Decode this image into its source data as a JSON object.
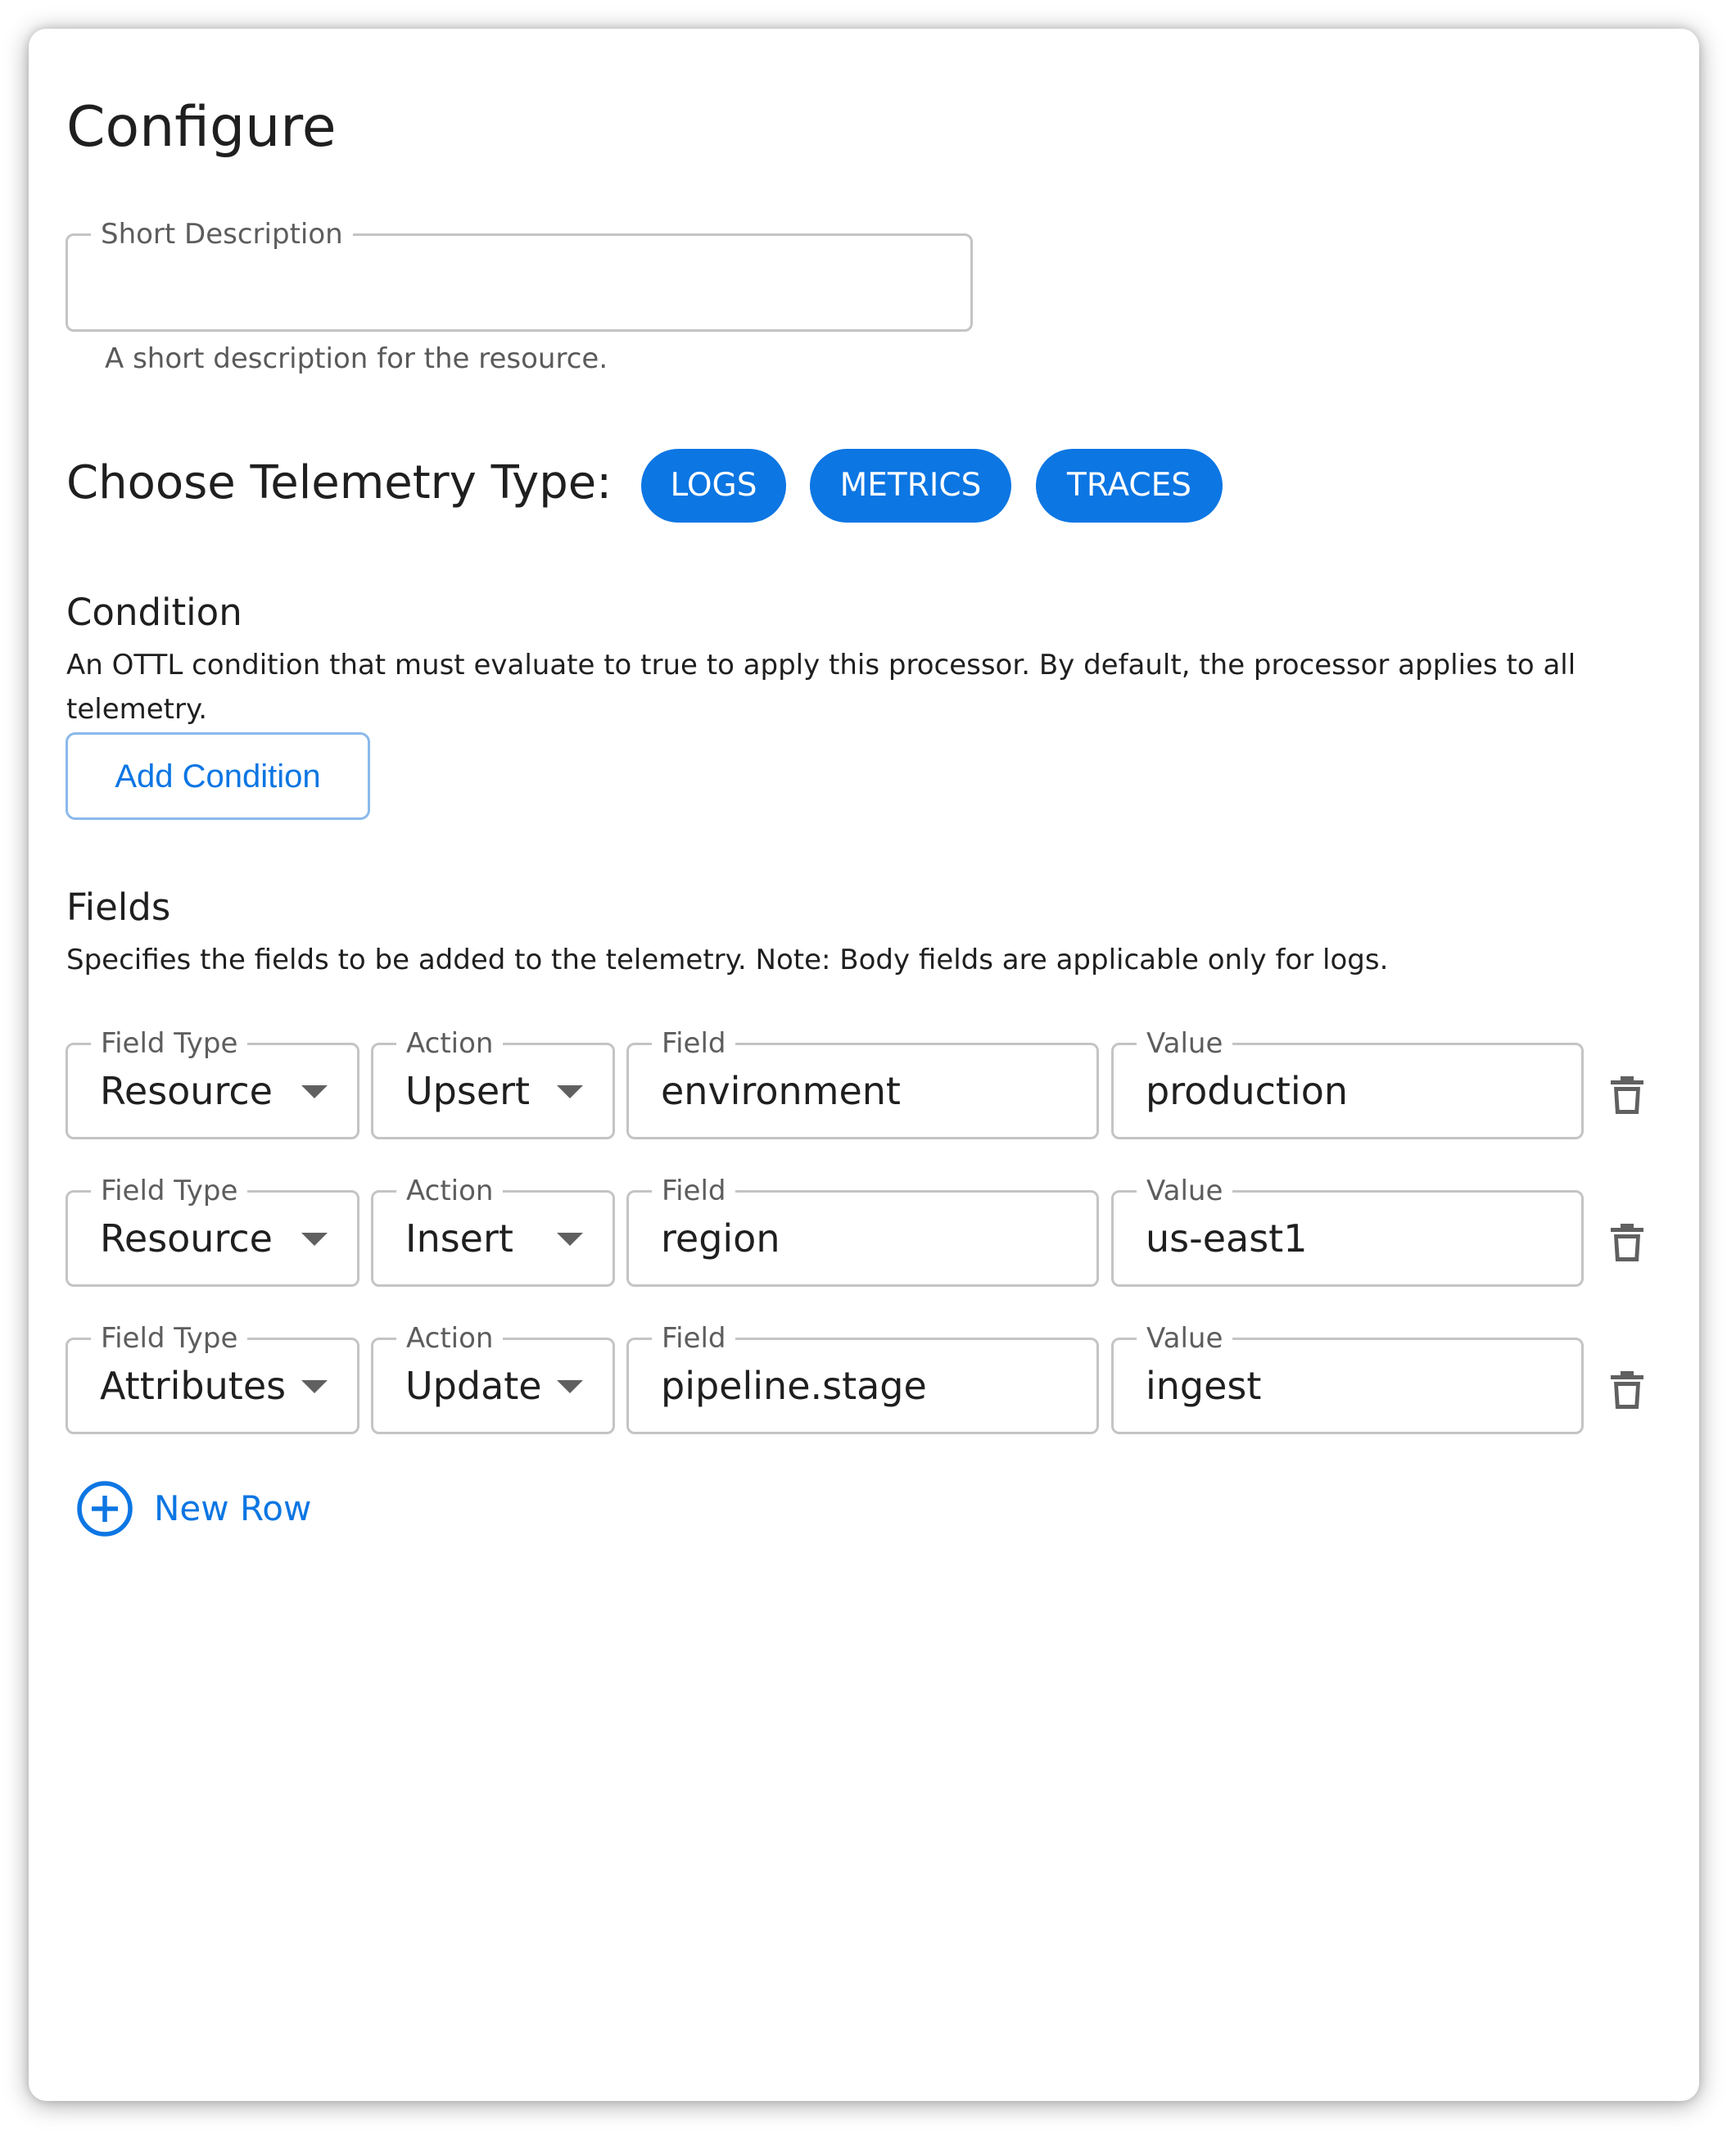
{
  "page": {
    "title": "Configure"
  },
  "short_description": {
    "label": "Short Description",
    "value": "",
    "helper": "A short description for the resource."
  },
  "telemetry": {
    "label": "Choose Telemetry Type:",
    "chips": [
      {
        "label": "LOGS",
        "selected": true
      },
      {
        "label": "METRICS",
        "selected": true
      },
      {
        "label": "TRACES",
        "selected": true
      }
    ]
  },
  "condition": {
    "title": "Condition",
    "description": "An OTTL condition that must evaluate to true to apply this processor. By default, the processor applies to all telemetry.",
    "add_label": "Add Condition"
  },
  "fields": {
    "title": "Fields",
    "description": "Specifies the fields to be added to the telemetry. Note: Body fields are applicable only for logs.",
    "column_labels": {
      "field_type": "Field Type",
      "action": "Action",
      "field": "Field",
      "value": "Value"
    },
    "rows": [
      {
        "field_type": "Resource",
        "action": "Upsert",
        "field": "environment",
        "value": "production"
      },
      {
        "field_type": "Resource",
        "action": "Insert",
        "field": "region",
        "value": "us-east1"
      },
      {
        "field_type": "Attributes",
        "action": "Update",
        "field": "pipeline.stage",
        "value": "ingest"
      }
    ],
    "new_row_label": "New Row"
  },
  "colors": {
    "accent": "#0c76e3",
    "border": "#c4c4c4",
    "text": "#1f1f1f",
    "muted": "#5d5d5d"
  },
  "icons": {
    "delete": "trash-icon",
    "add": "plus-circle-icon",
    "dropdown": "caret-down-icon"
  }
}
